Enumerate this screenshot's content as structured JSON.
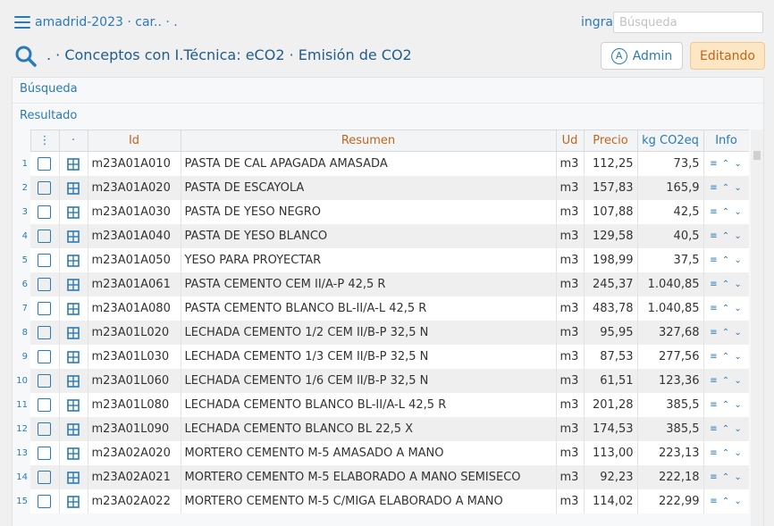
{
  "header": {
    "app_title": "amadrid-2023 · car.. · .",
    "ingra_label": "ingra",
    "search_placeholder": "Búsqueda",
    "page_title": ". · Conceptos con I.Técnica: eCO2 · Emisión de CO2",
    "admin_label": "Admin",
    "admin_badge": "A",
    "edit_label": "Editando"
  },
  "sections": {
    "busqueda": "Búsqueda",
    "resultado": "Resultado"
  },
  "table": {
    "columns": {
      "menu": "⋮",
      "dot": "·",
      "id": "Id",
      "resumen": "Resumen",
      "ud": "Ud",
      "precio": "Precio",
      "co2": "kg CO2eq",
      "info": "Info"
    },
    "info_glyphs": "≡ ⌃ ⌄",
    "rows": [
      {
        "n": "1",
        "id": "m23A01A010",
        "resumen": "PASTA DE CAL APAGADA AMASADA",
        "ud": "m3",
        "precio": "112,25",
        "co2": "73,5"
      },
      {
        "n": "2",
        "id": "m23A01A020",
        "resumen": "PASTA DE ESCAYOLA",
        "ud": "m3",
        "precio": "157,83",
        "co2": "165,9"
      },
      {
        "n": "3",
        "id": "m23A01A030",
        "resumen": "PASTA DE YESO NEGRO",
        "ud": "m3",
        "precio": "107,88",
        "co2": "42,5"
      },
      {
        "n": "4",
        "id": "m23A01A040",
        "resumen": "PASTA DE YESO BLANCO",
        "ud": "m3",
        "precio": "129,58",
        "co2": "40,5"
      },
      {
        "n": "5",
        "id": "m23A01A050",
        "resumen": "YESO PARA PROYECTAR",
        "ud": "m3",
        "precio": "198,99",
        "co2": "37,5"
      },
      {
        "n": "6",
        "id": "m23A01A061",
        "resumen": "PASTA CEMENTO CEM II/A-P 42,5 R",
        "ud": "m3",
        "precio": "245,37",
        "co2": "1.040,85"
      },
      {
        "n": "7",
        "id": "m23A01A080",
        "resumen": "PASTA CEMENTO BLANCO BL-II/A-L 42,5 R",
        "ud": "m3",
        "precio": "483,78",
        "co2": "1.040,85"
      },
      {
        "n": "8",
        "id": "m23A01L020",
        "resumen": "LECHADA CEMENTO 1/2 CEM II/B-P 32,5 N",
        "ud": "m3",
        "precio": "95,95",
        "co2": "327,68"
      },
      {
        "n": "9",
        "id": "m23A01L030",
        "resumen": "LECHADA CEMENTO 1/3 CEM II/B-P 32,5 N",
        "ud": "m3",
        "precio": "87,53",
        "co2": "277,56"
      },
      {
        "n": "10",
        "id": "m23A01L060",
        "resumen": "LECHADA CEMENTO 1/6 CEM II/B-P 32,5 N",
        "ud": "m3",
        "precio": "61,51",
        "co2": "123,36"
      },
      {
        "n": "11",
        "id": "m23A01L080",
        "resumen": "LECHADA CEMENTO BLANCO BL-II/A-L 42,5 R",
        "ud": "m3",
        "precio": "201,28",
        "co2": "385,5"
      },
      {
        "n": "12",
        "id": "m23A01L090",
        "resumen": "LECHADA CEMENTO BLANCO BL 22,5 X",
        "ud": "m3",
        "precio": "174,53",
        "co2": "385,5"
      },
      {
        "n": "13",
        "id": "m23A02A020",
        "resumen": "MORTERO CEMENTO M-5 AMASADO A MANO",
        "ud": "m3",
        "precio": "113,00",
        "co2": "223,13"
      },
      {
        "n": "14",
        "id": "m23A02A021",
        "resumen": "MORTERO CEMENTO M-5 ELABORADO A MANO SEMISECO",
        "ud": "m3",
        "precio": "92,23",
        "co2": "222,18"
      },
      {
        "n": "15",
        "id": "m23A02A022",
        "resumen": "MORTERO CEMENTO M-5 C/MIGA ELABORADO A MANO",
        "ud": "m3",
        "precio": "114,02",
        "co2": "222,99"
      }
    ]
  },
  "colors": {
    "link": "#2a7ab7",
    "header_text": "#c3641b",
    "edit_bg": "#fde6c4"
  }
}
